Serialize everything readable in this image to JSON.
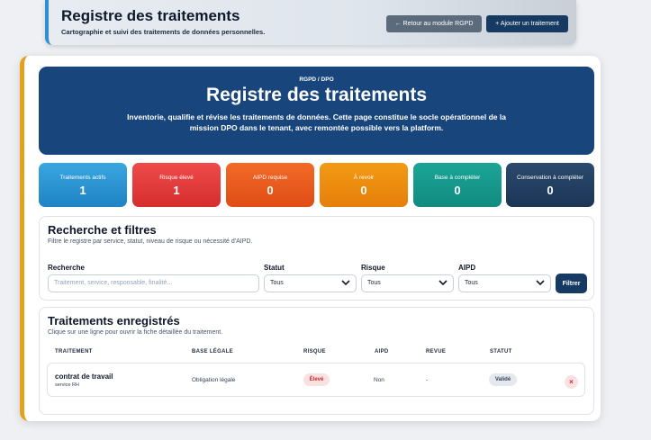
{
  "header": {
    "title": "Registre des traitements",
    "subtitle": "Cartographie et suivi des traitements de données personnelles.",
    "back_label": "← Retour au module RGPD",
    "add_label": "+ Ajouter un traitement"
  },
  "hero": {
    "kicker": "RGPD / DPO",
    "title": "Registre des traitements",
    "description": "Inventorie, qualifie et révise les traitements de données. Cette page constitue le socle opérationnel de la mission DPO dans le tenant, avec remontée possible vers la platform."
  },
  "kpis": [
    {
      "label": "Traitements actifs",
      "value": "1"
    },
    {
      "label": "Risque élevé",
      "value": "1"
    },
    {
      "label": "AIPD requise",
      "value": "0"
    },
    {
      "label": "À revoir",
      "value": "0"
    },
    {
      "label": "Base à compléter",
      "value": "0"
    },
    {
      "label": "Conservation à compléter",
      "value": "0"
    }
  ],
  "filters": {
    "title": "Recherche et filtres",
    "hint": "Filtre le registre par service, statut, niveau de risque ou nécessité d'AIPD.",
    "search_label": "Recherche",
    "search_placeholder": "Traitement, service, responsable, finalité...",
    "statut_label": "Statut",
    "statut_value": "Tous",
    "risque_label": "Risque",
    "risque_value": "Tous",
    "aipd_label": "AIPD",
    "aipd_value": "Tous",
    "filter_button": "Filtrer"
  },
  "records": {
    "title": "Traitements enregistrés",
    "hint": "Clique sur une ligne pour ouvrir la fiche détaillée du traitement.",
    "columns": [
      "TRAITEMENT",
      "BASE LÉGALE",
      "RISQUE",
      "AIPD",
      "REVUE",
      "STATUT"
    ],
    "rows": [
      {
        "name": "contrat de travail",
        "service": "service RH",
        "base": "Obligation légale",
        "risk": "Élevé",
        "aipd": "Non",
        "review": "-",
        "status": "Validé",
        "delete_symbol": "×"
      }
    ]
  }
}
